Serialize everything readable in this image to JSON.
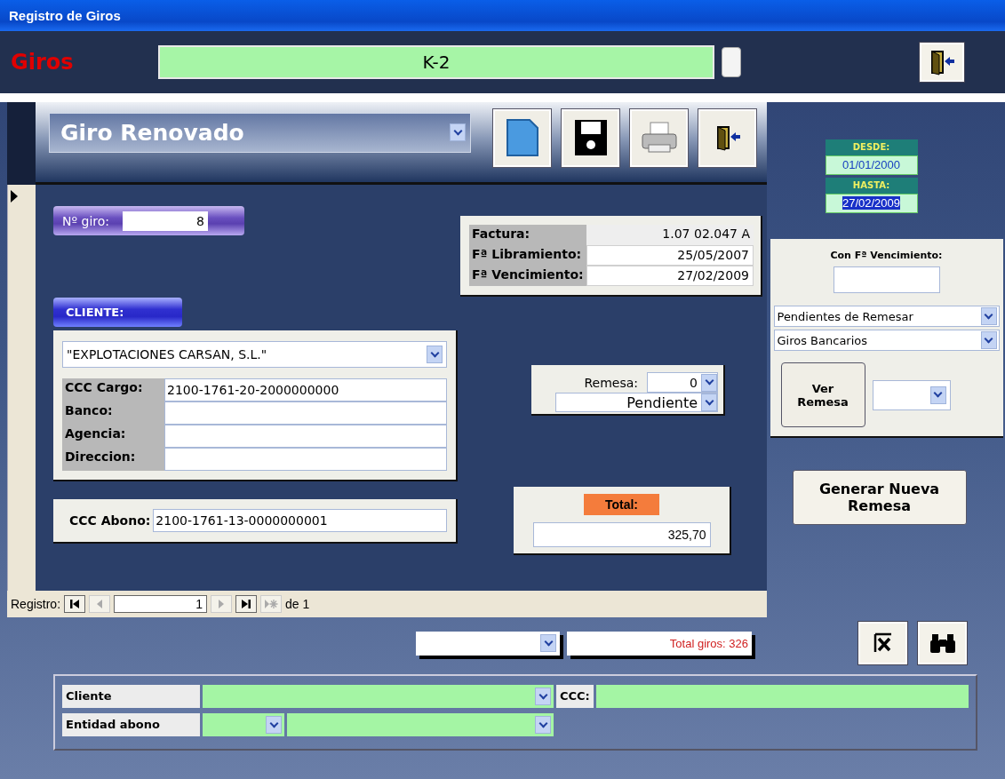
{
  "window": {
    "title": "Registro de Giros"
  },
  "header": {
    "title": "Giros",
    "code": "K-2"
  },
  "form": {
    "tipo": "Giro Renovado"
  },
  "numero_giro": {
    "label": "Nº giro:",
    "value": "8"
  },
  "cliente": {
    "label": "CLIENTE:",
    "name": "\"EXPLOTACIONES CARSAN, S.L.\"",
    "fields": [
      {
        "label": "CCC Cargo:",
        "value": "2100-1761-20-2000000000"
      },
      {
        "label": "Banco:"
      },
      {
        "label": "Agencia:"
      },
      {
        "label": "Direccion:"
      }
    ]
  },
  "ccc_abono": {
    "label": "CCC Abono:",
    "value": "2100-1761-13-0000000001"
  },
  "factura": [
    {
      "label": "Factura:",
      "value": "1.07 02.047 A",
      "kind": "plain"
    },
    {
      "label": "Fª Libramiento:",
      "value": "25/05/2007",
      "kind": "field"
    },
    {
      "label": "Fª Vencimiento:",
      "value": "27/02/2009",
      "kind": "field"
    }
  ],
  "remesa": {
    "label": "Remesa:",
    "value": "0",
    "estado": "Pendiente"
  },
  "total": {
    "label": "Total:",
    "value": "325,70"
  },
  "navigation": {
    "label": "Registro:",
    "current": "1",
    "of": "de 1",
    "buttons": [
      {
        "kind": "first",
        "disabled": false
      },
      {
        "kind": "prev",
        "disabled": true
      },
      {
        "kind": "field"
      },
      {
        "kind": "next",
        "disabled": true
      },
      {
        "kind": "last",
        "disabled": false
      },
      {
        "kind": "new",
        "disabled": true
      }
    ]
  },
  "fechas": {
    "desde_label": "DESDE:",
    "desde": "01/01/2000",
    "hasta_label": "HASTA:",
    "hasta": "27/02/2009"
  },
  "filtros": {
    "vencimiento_label": "Con Fª Vencimiento:",
    "estado": "Pendientes de Remesar",
    "tipo": "Giros Bancarios",
    "ver_button": "Ver Remesa"
  },
  "generar_button": "Generar Nueva Remesa",
  "total_giros": "Total giros: 326",
  "busqueda": {
    "cliente_label": "Cliente",
    "ccc_label": "CCC:",
    "entidad_label": "Entidad abono"
  }
}
